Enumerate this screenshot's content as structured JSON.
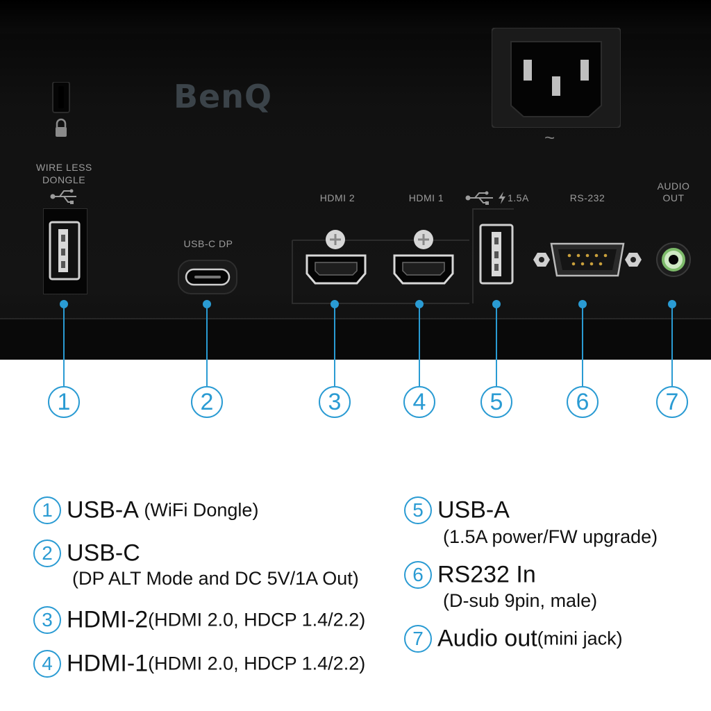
{
  "brand": "BenQ",
  "ports": {
    "wireless_label_1": "WIRE LESS",
    "wireless_label_2": "DONGLE",
    "usbc_label": "USB-C DP",
    "hdmi2_label": "HDMI 2",
    "hdmi1_label": "HDMI 1",
    "usb_power_label": "1.5A",
    "rs232_label": "RS-232",
    "audio_label_1": "AUDIO",
    "audio_label_2": "OUT",
    "power_symbol": "~"
  },
  "callouts": [
    "1",
    "2",
    "3",
    "4",
    "5",
    "6",
    "7"
  ],
  "legend": [
    {
      "num": "1",
      "title": "USB-A",
      "detail": " (WiFi Dongle)"
    },
    {
      "num": "2",
      "title": "USB-C",
      "detail": "(DP ALT Mode and DC 5V/1A Out)"
    },
    {
      "num": "3",
      "title": "HDMI-2",
      "detail": "(HDMI 2.0, HDCP 1.4/2.2)"
    },
    {
      "num": "4",
      "title": "HDMI-1",
      "detail": "(HDMI 2.0, HDCP 1.4/2.2)"
    },
    {
      "num": "5",
      "title": "USB-A",
      "detail": "(1.5A power/FW upgrade)"
    },
    {
      "num": "6",
      "title": "RS232 In",
      "detail": "(D-sub 9pin, male)"
    },
    {
      "num": "7",
      "title": "Audio out",
      "detail": "(mini jack)"
    }
  ],
  "colors": {
    "accent": "#2a9bd3",
    "panel": "#141414",
    "label": "#9c9c9c"
  }
}
